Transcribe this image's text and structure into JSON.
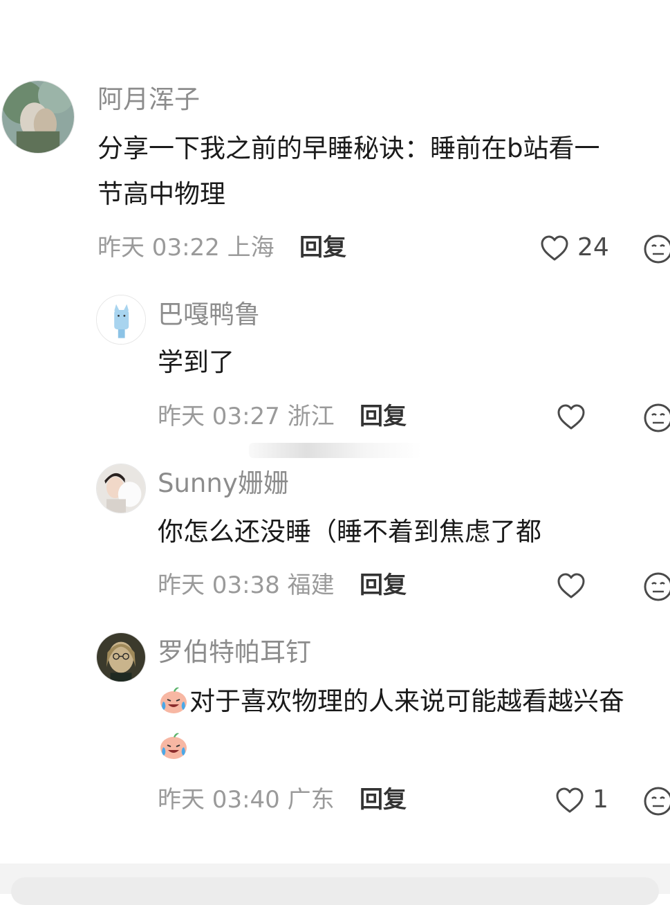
{
  "comments": [
    {
      "username": "阿月浑子",
      "text_lines": [
        "分享一下我之前的早睡秘诀：睡前在b站看一",
        "节高中物理"
      ],
      "time": "昨天 03:22 上海",
      "reply_label": "回复",
      "likes": "24"
    },
    {
      "username": "巴嘎鸭鲁",
      "text_lines": [
        "学到了"
      ],
      "time": "昨天 03:27 浙江",
      "reply_label": "回复",
      "likes": ""
    },
    {
      "username": "Sunny姗姗",
      "text_lines": [
        "你怎么还没睡（睡不着到焦虑了都"
      ],
      "time": "昨天 03:38 福建",
      "reply_label": "回复",
      "likes": ""
    },
    {
      "username": "罗伯特帕耳钉",
      "text_lines": [
        "对于喜欢物理的人来说可能越看越兴奋"
      ],
      "time": "昨天 03:40 广东",
      "reply_label": "回复",
      "likes": "1"
    }
  ],
  "icons": {
    "like": "heart-outline-icon",
    "dislike": "neutral-face-icon",
    "emoji": "crying-laughing-peach-emoji"
  },
  "colors": {
    "username": "#8c8c8c",
    "meta": "#9a9a9a",
    "body_text": "#1a1a1a",
    "reply": "#333333"
  }
}
